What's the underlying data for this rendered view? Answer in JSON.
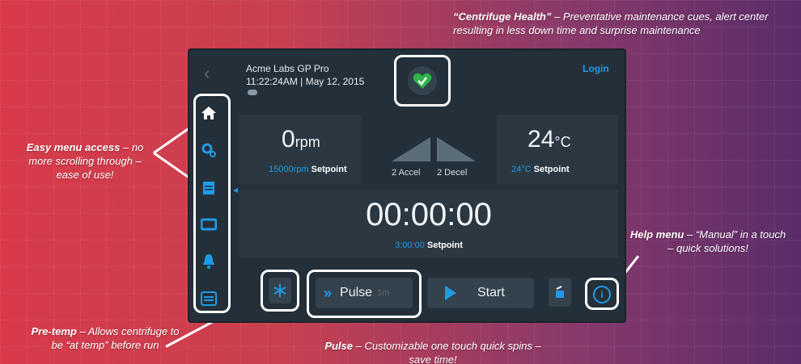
{
  "device": {
    "name": "Acme Labs GP Pro",
    "datetime": "11:22:24AM | May 12, 2015",
    "login": "Login"
  },
  "speed": {
    "value": "0",
    "unit": "rpm",
    "setpoint_value": "15000rpm",
    "setpoint_label": "Setpoint"
  },
  "accel": {
    "accel": "2 Accel",
    "decel": "2 Decel"
  },
  "temp": {
    "value": "24",
    "unit": "°C",
    "setpoint_value": "24°C",
    "setpoint_label": "Setpoint"
  },
  "timer": {
    "value": "00:00:00",
    "setpoint_value": "3:00:00",
    "setpoint_label": "Setpoint"
  },
  "buttons": {
    "pulse": "Pulse",
    "pulse_time": "1m",
    "start": "Start"
  },
  "sidebar": {
    "items": [
      {
        "icon": "home-icon"
      },
      {
        "icon": "settings-gears-icon"
      },
      {
        "icon": "calendar-icon"
      },
      {
        "icon": "display-icon"
      },
      {
        "icon": "bell-icon"
      },
      {
        "icon": "list-icon"
      }
    ]
  },
  "callouts": {
    "health_title": "“Centrifuge Health”",
    "health_text": " – Preventative maintenance cues, alert center resulting in less down time and surprise maintenance",
    "menu_title": "Easy menu access",
    "menu_text": " – no more scrolling through – ease of use!",
    "help_title": "Help menu",
    "help_text": " – “Manual” in a touch – quick solutions!",
    "pretemp_title": "Pre-temp",
    "pretemp_text": " – Allows centrifuge to be “at temp” before run",
    "pulse_title": "Pulse",
    "pulse_text": " – Customizable one touch quick spins – save time!"
  },
  "colors": {
    "accent": "#1e9be8",
    "health": "#2fb34a",
    "screen": "#243039"
  }
}
